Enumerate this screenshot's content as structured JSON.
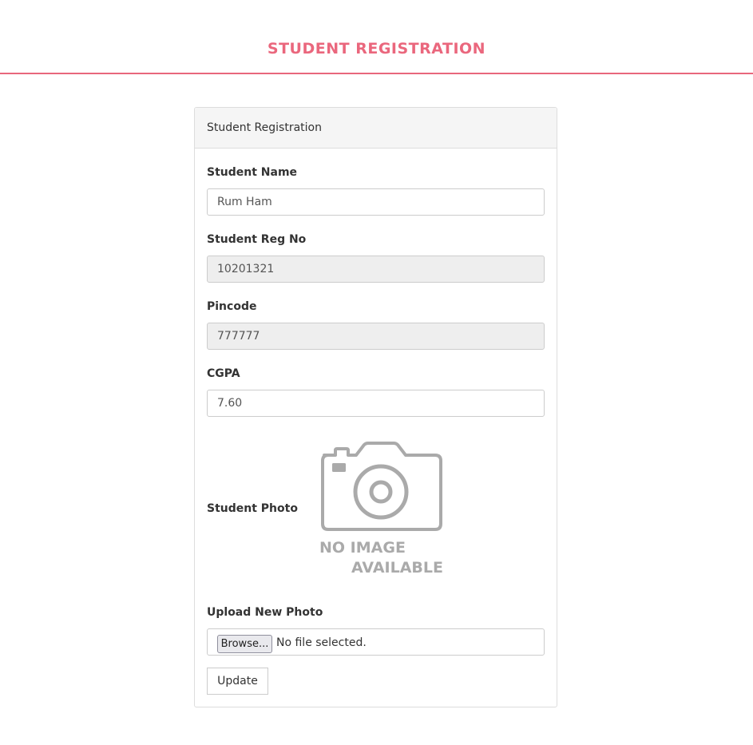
{
  "header": {
    "title": "STUDENT REGISTRATION",
    "accent_color": "#ea677d"
  },
  "panel": {
    "heading": "Student Registration"
  },
  "form": {
    "student_name": {
      "label": "Student Name",
      "value": "Rum Ham"
    },
    "reg_no": {
      "label": "Student Reg No",
      "value": "10201321"
    },
    "pincode": {
      "label": "Pincode",
      "value": "777777"
    },
    "cgpa": {
      "label": "CGPA",
      "value": "7.60"
    },
    "photo": {
      "label": "Student Photo",
      "placeholder_icon": "camera-icon",
      "placeholder_line1": "NO IMAGE",
      "placeholder_line2": "AVAILABLE"
    },
    "upload": {
      "label": "Upload New Photo",
      "browse_label": "Browse...",
      "status": "No file selected."
    },
    "update_label": "Update"
  }
}
